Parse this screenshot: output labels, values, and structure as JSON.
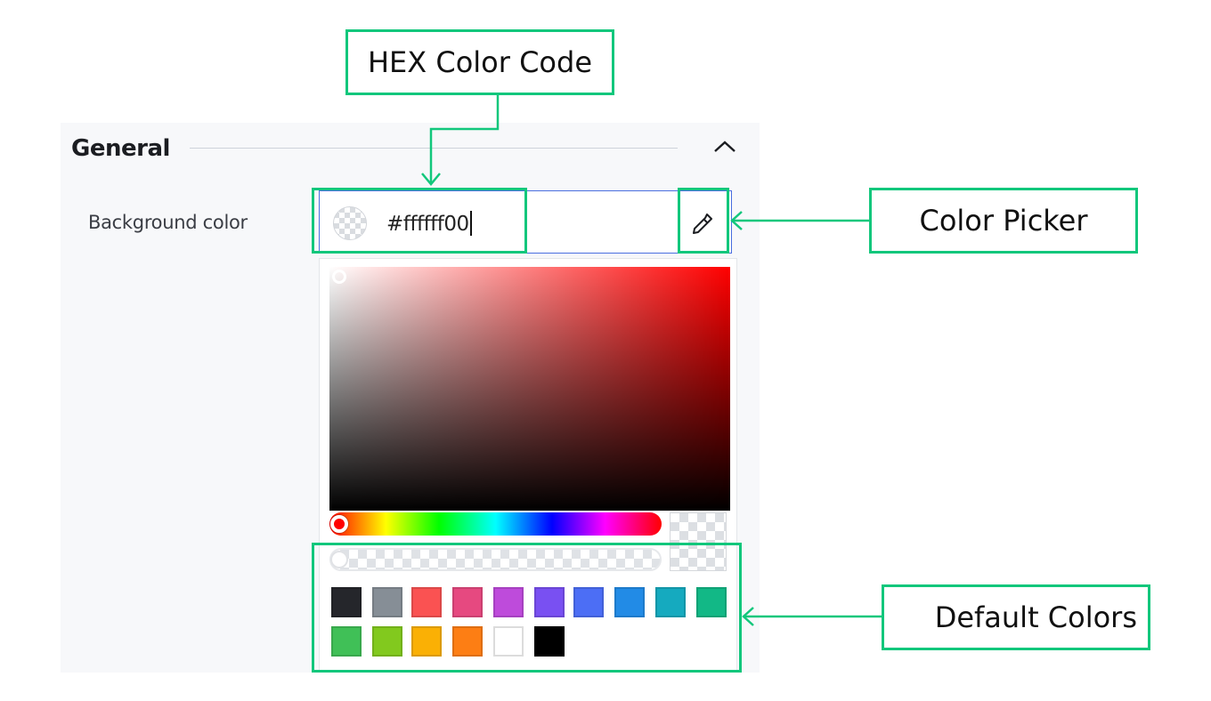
{
  "section": {
    "title": "General",
    "collapse_icon": "chevron-up-icon"
  },
  "field": {
    "label": "Background color",
    "hex_value": "#ffffff00",
    "eyedropper_icon": "eyedropper-icon"
  },
  "picker": {
    "hue_color": "#ff0000",
    "hue_value": 0,
    "saturation": 0,
    "brightness": 1,
    "alpha": 0
  },
  "default_colors": [
    "#25262b",
    "#868e96",
    "#fa5252",
    "#e64980",
    "#be4bdb",
    "#7950f2",
    "#4c6ef5",
    "#228be6",
    "#15aabf",
    "#12b886",
    "#40c057",
    "#82c91e",
    "#fab005",
    "#fd7e14",
    "#ffffff",
    "#000000"
  ],
  "annotations": {
    "hex_code": "HEX Color Code",
    "color_picker": "Color Picker",
    "default_colors": "Default Colors",
    "accent_color": "#12c77c"
  }
}
